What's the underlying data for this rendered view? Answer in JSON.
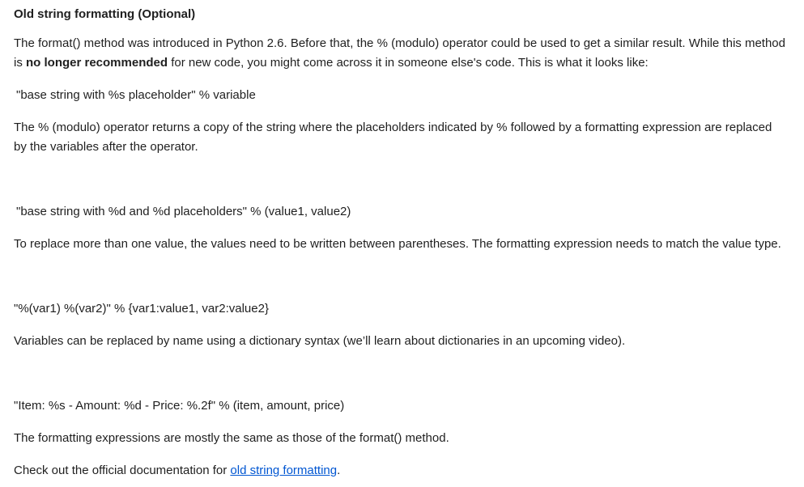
{
  "heading": "Old string formatting (Optional)",
  "intro": {
    "part1": "The format() method was introduced in Python 2.6. Before that, the % (modulo) operator could be used to get a similar result. While this method is ",
    "bold": "no longer recommended",
    "part2": " for new code, you might come across it in someone else's code. This is what it looks like:"
  },
  "code1": "\"base string with %s placeholder\" % variable",
  "para2": "The % (modulo) operator returns a copy of the string where the placeholders indicated by %  followed by a formatting expression are replaced by the variables after the operator.",
  "code2": "\"base string with %d and %d placeholders\" % (value1, value2)",
  "para3": "To replace more than one value, the values need to be written between parentheses. The formatting expression needs to match the value type.",
  "code3": "\"%(var1) %(var2)\" % {var1:value1, var2:value2}",
  "para4": "Variables can be replaced by name using a dictionary syntax (we’ll learn about dictionaries in an upcoming video).",
  "code4": "\"Item: %s - Amount: %d - Price: %.2f\" % (item, amount, price)",
  "para5": "The formatting expressions are mostly the same as those of the format() method.",
  "closing": {
    "prefix": "Check out the official documentation for ",
    "link_text": "old string formatting",
    "suffix": "."
  }
}
